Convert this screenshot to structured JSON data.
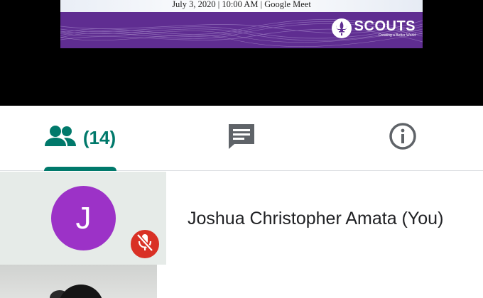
{
  "presentation": {
    "banner_date_line": "July 3, 2020 | 10:00 AM | Google Meet",
    "logo_word": "SCOUTS",
    "logo_tagline": "Creating a Better World",
    "logo_icon": "fleur-de-lis-icon",
    "colors": {
      "banner_purple": "#5f2d91",
      "background": "#000000"
    }
  },
  "tabs": [
    {
      "name": "people",
      "icon": "people-icon",
      "count_label": "(14)",
      "active": true
    },
    {
      "name": "chat",
      "icon": "chat-icon",
      "active": false
    },
    {
      "name": "info",
      "icon": "info-icon",
      "active": false
    }
  ],
  "participants": [
    {
      "initial": "J",
      "name": "Joshua Christopher Amata (You)",
      "muted": true,
      "status_icon": "mic-off-icon",
      "avatar_color": "#9c32c7"
    },
    {
      "type": "video-tile"
    }
  ],
  "colors": {
    "accent": "#00796b",
    "mute_red": "#d93025",
    "tile_bg": "#e6ebe8"
  }
}
